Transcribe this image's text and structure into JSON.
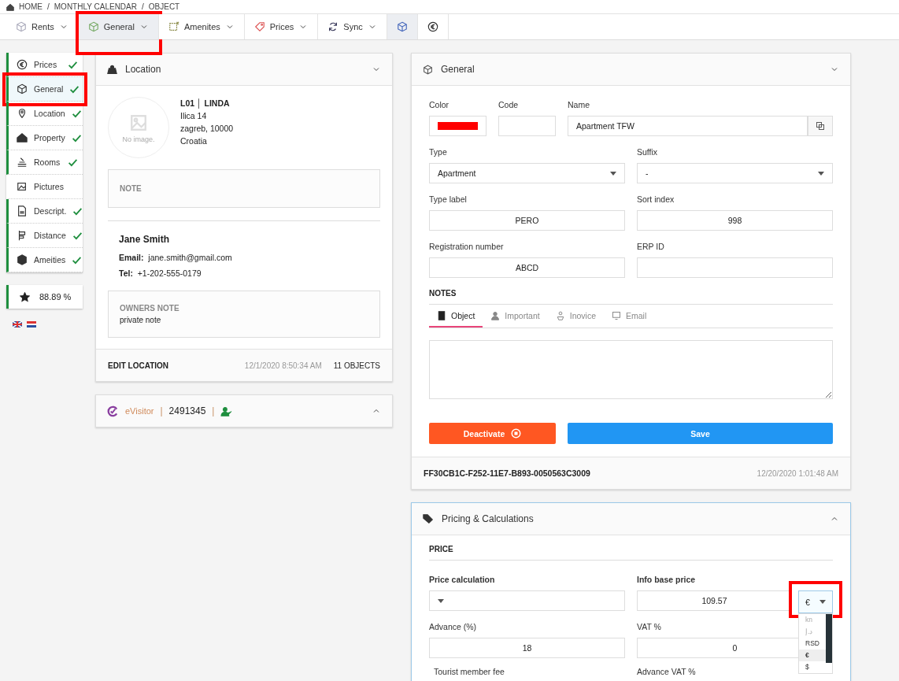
{
  "breadcrumb": {
    "items": [
      "HOME",
      "MONTHLY CALENDAR",
      "OBJECT"
    ],
    "separator": "/"
  },
  "toolbar": [
    {
      "kind": "menu",
      "label": "Rents",
      "selected": false,
      "highlighted": false
    },
    {
      "kind": "menu",
      "label": "General",
      "selected": true,
      "highlighted": true
    },
    {
      "kind": "menu",
      "label": "Amenites",
      "selected": false,
      "highlighted": false
    },
    {
      "kind": "menu",
      "label": "Prices",
      "selected": false,
      "highlighted": false
    },
    {
      "kind": "menu",
      "label": "Sync",
      "selected": false,
      "highlighted": false
    },
    {
      "kind": "icon",
      "selected": true,
      "highlighted": false
    },
    {
      "kind": "icon",
      "selected": false,
      "highlighted": false
    }
  ],
  "sidebar": {
    "items": [
      {
        "label": "Prices",
        "checked": true,
        "selected": false,
        "highlighted": false
      },
      {
        "label": "General",
        "checked": true,
        "selected": true,
        "highlighted": true
      },
      {
        "label": "Location",
        "checked": true,
        "selected": false,
        "highlighted": false
      },
      {
        "label": "Property",
        "checked": true,
        "selected": false,
        "highlighted": false
      },
      {
        "label": "Rooms",
        "checked": true,
        "selected": false,
        "highlighted": false
      },
      {
        "label": "Pictures",
        "checked": false,
        "selected": false,
        "highlighted": false
      },
      {
        "label": "Descript.",
        "checked": true,
        "selected": false,
        "highlighted": false
      },
      {
        "label": "Distance",
        "checked": true,
        "selected": false,
        "highlighted": false
      },
      {
        "label": "Ameities",
        "checked": true,
        "selected": false,
        "highlighted": false
      }
    ],
    "score": "88.89 %"
  },
  "location": {
    "title": "Location",
    "placeholder_text": "No image.",
    "code": "L01",
    "code_separator": "│",
    "name": "LINDA",
    "address": [
      "Ilica 14",
      "zagreb, 10000",
      "Croatia"
    ],
    "note_label": "NOTE",
    "contact_name": "Jane Smith",
    "email_label": "Email:",
    "email": "jane.smith@gmail.com",
    "tel_label": "Tel:",
    "tel": "+1-202-555-0179",
    "owners_note_label": "OWNERS NOTE",
    "owners_note": "private note",
    "edit_link": "EDIT LOCATION",
    "updated": "12/1/2020 8:50:34 AM",
    "objects": "11 OBJECTS"
  },
  "evisitor": {
    "logo": "eVisitor",
    "separator": "|",
    "id": "2491345"
  },
  "general": {
    "title": "General",
    "color_label": "Color",
    "color": "#ff0000",
    "code_label": "Code",
    "name_label": "Name",
    "name": "Apartment TFW",
    "type_label": "Type",
    "type": "Apartment",
    "suffix_label": "Suffix",
    "suffix": "-",
    "type_label_label": "Type label",
    "type_label_value": "PERO",
    "sort_index_label": "Sort index",
    "sort_index": "998",
    "registration_label": "Registration number",
    "registration": "ABCD",
    "erp_label": "ERP ID",
    "notes_heading": "NOTES",
    "note_tabs": [
      {
        "label": "Object",
        "selected": true
      },
      {
        "label": "Important",
        "selected": false
      },
      {
        "label": "Inovice",
        "selected": false
      },
      {
        "label": "Email",
        "selected": false
      }
    ],
    "deactivate": "Deactivate",
    "save": "Save",
    "guid": "FF30CB1C-F252-11E7-B893-0050563C3009",
    "updated": "12/20/2020 1:01:48 AM"
  },
  "pricing": {
    "title": "Pricing & Calculations",
    "section": "PRICE",
    "price_calc_label": "Price calculation",
    "info_base_label": "Info base price",
    "info_base": "109.57",
    "currency": {
      "value": "€",
      "highlighted": true,
      "options": [
        {
          "label": "kn",
          "selected": false
        },
        {
          "label": "د.إ",
          "selected": false
        },
        {
          "label": "RSD",
          "selected": false
        },
        {
          "label": "€",
          "selected": true
        },
        {
          "label": "$",
          "selected": false
        }
      ]
    },
    "advance_label": "Advance (%)",
    "advance": "18",
    "vat_label": "VAT %",
    "vat": "0",
    "tourist_fee_label": "Tourist member fee",
    "advance_vat_label": "Advance VAT %"
  }
}
